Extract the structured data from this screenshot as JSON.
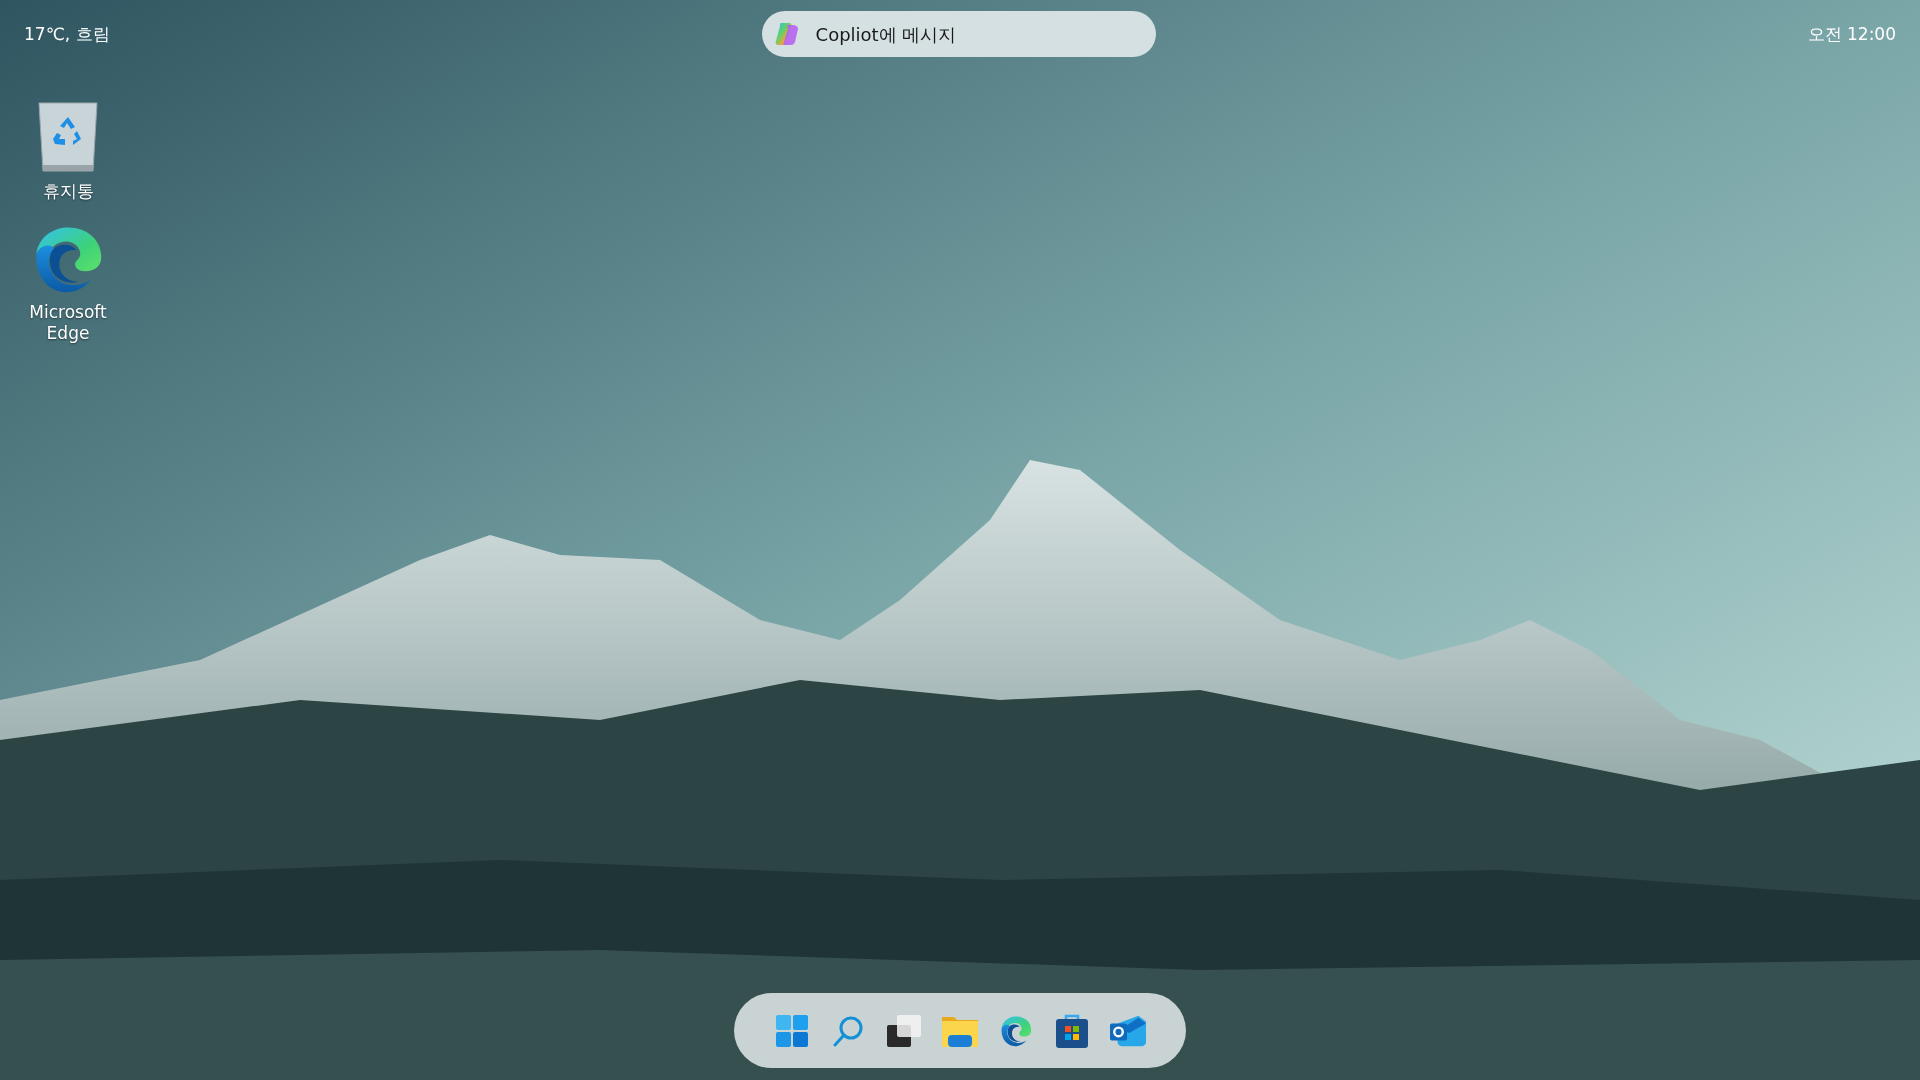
{
  "top_bar": {
    "weather": "17℃, 흐림",
    "copilot": {
      "placeholder": "Copliot에 메시지"
    },
    "clock": "오전 12:00"
  },
  "desktop_icons": [
    {
      "kind": "recycle-bin",
      "label": "휴지통"
    },
    {
      "kind": "edge",
      "label": "Microsoft Edge"
    }
  ],
  "taskbar": [
    {
      "kind": "start"
    },
    {
      "kind": "search"
    },
    {
      "kind": "task-view"
    },
    {
      "kind": "files"
    },
    {
      "kind": "edge"
    },
    {
      "kind": "store"
    },
    {
      "kind": "outlook"
    }
  ]
}
